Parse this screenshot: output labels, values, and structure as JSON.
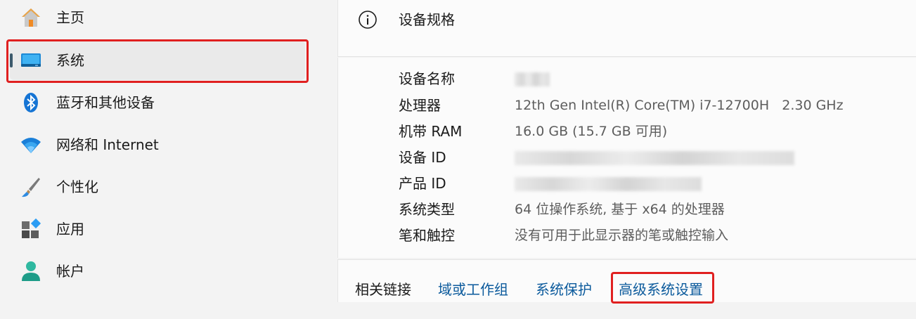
{
  "sidebar": {
    "items": [
      {
        "label": "主页",
        "icon": "home-icon"
      },
      {
        "label": "系统",
        "icon": "system-icon",
        "active": true
      },
      {
        "label": "蓝牙和其他设备",
        "icon": "bluetooth-icon"
      },
      {
        "label": "网络和 Internet",
        "icon": "wifi-icon"
      },
      {
        "label": "个性化",
        "icon": "paintbrush-icon"
      },
      {
        "label": "应用",
        "icon": "apps-icon"
      },
      {
        "label": "帐户",
        "icon": "account-icon"
      }
    ]
  },
  "section": {
    "title": "设备规格",
    "icon": "info-icon"
  },
  "specs": [
    {
      "key": "设备名称",
      "value": ""
    },
    {
      "key": "处理器",
      "value": "12th Gen Intel(R) Core(TM) i7-12700H   2.30 GHz"
    },
    {
      "key": "机带 RAM",
      "value": "16.0 GB (15.7 GB 可用)"
    },
    {
      "key": "设备 ID",
      "value": ""
    },
    {
      "key": "产品 ID",
      "value": ""
    },
    {
      "key": "系统类型",
      "value": "64 位操作系统, 基于 x64 的处理器"
    },
    {
      "key": "笔和触控",
      "value": "没有可用于此显示器的笔或触控输入"
    }
  ],
  "related_links": {
    "title": "相关链接",
    "items": [
      "域或工作组",
      "系统保护",
      "高级系统设置"
    ]
  },
  "colors": {
    "highlight": "#e02020",
    "link": "#0b5a9c",
    "active_indicator": "#3d5a6c"
  }
}
